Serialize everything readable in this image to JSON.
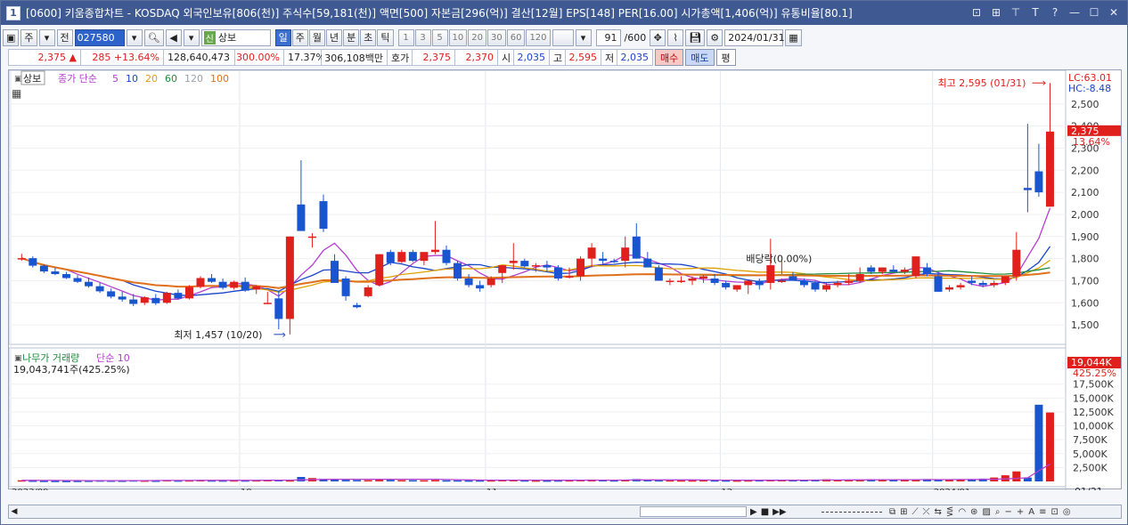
{
  "window": {
    "badge": "1",
    "title": "[0600] 키움종합차트 - KOSDAQ 외국인보유[806(천)] 주식수[59,181(천)] 액면[500] 자본금[296(억)] 결산[12월] EPS[148] PER[16.00] 시가총액[1,406(억)] 유통비율[80.1]",
    "title_buttons": [
      "⊡",
      "⊞",
      "⊤",
      "T",
      "?",
      "—",
      "☐",
      "✕"
    ]
  },
  "toolbar": {
    "ju": "주",
    "jeon": "전",
    "code": "027580",
    "shin": "신",
    "name": "상보",
    "periods": [
      "일",
      "주",
      "월",
      "년",
      "분",
      "초",
      "틱"
    ],
    "active_period": "일",
    "intervals": [
      "1",
      "3",
      "5",
      "10",
      "20",
      "30",
      "60",
      "120"
    ],
    "count": "91",
    "count_max": "/600",
    "date": "2024/01/31"
  },
  "quote": {
    "price": "2,375",
    "change": "285",
    "change_pct": "+13.64%",
    "volume": "128,640,473",
    "vol_pct": "300.00%",
    "turnover": "17.37%",
    "amount": "306,108백만",
    "hoga_label": "호가",
    "ask": "2,375",
    "bid": "2,370",
    "open_label": "시",
    "open": "2,035",
    "high_label": "고",
    "high": "2,595",
    "low_label": "저",
    "low": "2,035",
    "buy": "매수",
    "sell": "매도",
    "flat": "평"
  },
  "price_panel": {
    "stock_label": "상보",
    "ma_label": "종가 단순",
    "ma_periods": [
      "5",
      "10",
      "20",
      "60",
      "120",
      "100"
    ],
    "ma_colors": [
      "#b43fd0",
      "#1a45c8",
      "#e0a000",
      "#1e8c3a",
      "#9aa0b0",
      "#e0701c"
    ],
    "lc": "LC:63.01",
    "hc": "HC:-8.48",
    "max_annot": "최고 2,595 (01/31)",
    "min_annot": "최저 1,457 (10/20)",
    "dividend_annot": "배당락(0.00%)",
    "last_price_tag": "2,375",
    "last_pct_tag": "13.64%"
  },
  "volume_panel": {
    "label": "나무가 거래량",
    "ma_label": "단순 10",
    "value_line": "19,043,741주(425.25%)",
    "last_tag": "19,044K",
    "last_pct": "425.25%"
  },
  "x_axis": {
    "labels": [
      "2023/09",
      "10",
      "11",
      "12",
      "2024/01"
    ],
    "right_label": "01/31"
  },
  "chart_data": {
    "type": "candlestick",
    "price_axis": {
      "ticks": [
        1500,
        1600,
        1700,
        1800,
        1900,
        2000,
        2100,
        2200,
        2300,
        2400,
        2500
      ],
      "range": [
        1420,
        2620
      ]
    },
    "volume_axis": {
      "ticks": [
        "2,500K",
        "5,000K",
        "7,500K",
        "10,000K",
        "12,500K",
        "15,000K",
        "17,500K"
      ],
      "range_k": [
        0,
        20500
      ]
    },
    "candles": [
      [
        1800,
        1822,
        1790,
        1802
      ],
      [
        1802,
        1810,
        1760,
        1768
      ],
      [
        1768,
        1775,
        1735,
        1742
      ],
      [
        1742,
        1760,
        1725,
        1730
      ],
      [
        1730,
        1740,
        1708,
        1712
      ],
      [
        1712,
        1725,
        1690,
        1695
      ],
      [
        1695,
        1715,
        1668,
        1675
      ],
      [
        1675,
        1690,
        1645,
        1652
      ],
      [
        1652,
        1665,
        1620,
        1628
      ],
      [
        1628,
        1650,
        1605,
        1615
      ],
      [
        1615,
        1640,
        1585,
        1595
      ],
      [
        1600,
        1630,
        1590,
        1625
      ],
      [
        1622,
        1640,
        1590,
        1598
      ],
      [
        1600,
        1650,
        1595,
        1645
      ],
      [
        1645,
        1660,
        1615,
        1620
      ],
      [
        1620,
        1680,
        1615,
        1672
      ],
      [
        1672,
        1720,
        1665,
        1712
      ],
      [
        1712,
        1730,
        1690,
        1695
      ],
      [
        1695,
        1710,
        1660,
        1668
      ],
      [
        1668,
        1700,
        1660,
        1695
      ],
      [
        1695,
        1715,
        1650,
        1655
      ],
      [
        1660,
        1680,
        1640,
        1675
      ],
      [
        1598,
        1650,
        1595,
        1600
      ],
      [
        1620,
        1655,
        1480,
        1527
      ],
      [
        1527,
        1900,
        1457,
        1900
      ],
      [
        2045,
        2245,
        2035,
        1925
      ],
      [
        1900,
        1915,
        1850,
        1900
      ],
      [
        2060,
        2090,
        1920,
        1935
      ],
      [
        1790,
        1820,
        1700,
        1690
      ],
      [
        1710,
        1720,
        1610,
        1630
      ],
      [
        1590,
        1600,
        1575,
        1580
      ],
      [
        1630,
        1680,
        1625,
        1670
      ],
      [
        1680,
        1820,
        1675,
        1820
      ],
      [
        1830,
        1840,
        1770,
        1780
      ],
      [
        1785,
        1840,
        1780,
        1830
      ],
      [
        1830,
        1840,
        1785,
        1790
      ],
      [
        1790,
        1800,
        1770,
        1830
      ],
      [
        1830,
        1970,
        1820,
        1840
      ],
      [
        1840,
        1860,
        1770,
        1780
      ],
      [
        1780,
        1790,
        1700,
        1710
      ],
      [
        1710,
        1730,
        1670,
        1680
      ],
      [
        1680,
        1700,
        1650,
        1665
      ],
      [
        1680,
        1720,
        1670,
        1710
      ],
      [
        1735,
        1760,
        1690,
        1770
      ],
      [
        1780,
        1870,
        1750,
        1790
      ],
      [
        1790,
        1800,
        1760,
        1765
      ],
      [
        1765,
        1780,
        1740,
        1770
      ],
      [
        1770,
        1790,
        1740,
        1760
      ],
      [
        1760,
        1770,
        1700,
        1710
      ],
      [
        1720,
        1760,
        1710,
        1720
      ],
      [
        1720,
        1810,
        1700,
        1800
      ],
      [
        1800,
        1870,
        1760,
        1850
      ],
      [
        1800,
        1830,
        1775,
        1790
      ],
      [
        1790,
        1800,
        1780,
        1785
      ],
      [
        1790,
        1900,
        1760,
        1850
      ],
      [
        1900,
        1960,
        1800,
        1800
      ],
      [
        1800,
        1830,
        1760,
        1760
      ],
      [
        1760,
        1770,
        1700,
        1700
      ],
      [
        1700,
        1710,
        1680,
        1700
      ],
      [
        1700,
        1720,
        1690,
        1700
      ],
      [
        1700,
        1720,
        1680,
        1710
      ],
      [
        1710,
        1725,
        1690,
        1720
      ],
      [
        1710,
        1730,
        1680,
        1690
      ],
      [
        1690,
        1700,
        1660,
        1670
      ],
      [
        1660,
        1680,
        1650,
        1680
      ],
      [
        1680,
        1700,
        1640,
        1700
      ],
      [
        1700,
        1710,
        1660,
        1680
      ],
      [
        1690,
        1890,
        1660,
        1770
      ],
      [
        1700,
        1710,
        1690,
        1700
      ],
      [
        1720,
        1740,
        1700,
        1700
      ],
      [
        1700,
        1710,
        1670,
        1680
      ],
      [
        1690,
        1700,
        1650,
        1660
      ],
      [
        1660,
        1690,
        1650,
        1680
      ],
      [
        1680,
        1700,
        1670,
        1690
      ],
      [
        1690,
        1730,
        1680,
        1700
      ],
      [
        1700,
        1760,
        1690,
        1730
      ],
      [
        1760,
        1770,
        1730,
        1740
      ],
      [
        1740,
        1760,
        1730,
        1760
      ],
      [
        1750,
        1770,
        1740,
        1740
      ],
      [
        1740,
        1760,
        1730,
        1750
      ],
      [
        1720,
        1810,
        1710,
        1810
      ],
      [
        1760,
        1780,
        1720,
        1730
      ],
      [
        1720,
        1740,
        1650,
        1650
      ],
      [
        1660,
        1680,
        1650,
        1670
      ],
      [
        1670,
        1690,
        1660,
        1680
      ],
      [
        1700,
        1720,
        1680,
        1690
      ],
      [
        1690,
        1700,
        1670,
        1680
      ],
      [
        1680,
        1700,
        1670,
        1690
      ],
      [
        1690,
        1720,
        1680,
        1720
      ],
      [
        1720,
        1920,
        1700,
        1840
      ],
      [
        2120,
        2410,
        2010,
        2110
      ],
      [
        2195,
        2320,
        2080,
        2100
      ],
      [
        2035,
        2595,
        2035,
        2375
      ]
    ],
    "volumes_k": [
      200,
      150,
      120,
      110,
      100,
      120,
      140,
      180,
      160,
      150,
      200,
      170,
      150,
      230,
      180,
      200,
      230,
      190,
      180,
      200,
      190,
      210,
      240,
      280,
      200,
      800,
      600,
      450,
      330,
      280,
      240,
      230,
      300,
      280,
      230,
      220,
      210,
      250,
      200,
      200,
      180,
      190,
      200,
      240,
      260,
      200,
      180,
      170,
      190,
      210,
      300,
      340,
      230,
      200,
      250,
      420,
      250,
      220,
      210,
      200,
      200,
      220,
      200,
      190,
      180,
      200,
      220,
      240,
      260,
      220,
      300,
      340,
      380,
      300,
      320,
      340,
      260,
      300,
      280,
      260,
      290,
      420,
      400,
      350,
      360,
      420,
      500,
      700,
      1100,
      1800,
      700,
      13800,
      12400,
      5400,
      19044
    ],
    "volume_ma": [
      200,
      190,
      180,
      170,
      160,
      155,
      150,
      150,
      150,
      150,
      150,
      150,
      160,
      170,
      170,
      180,
      190,
      195,
      200,
      200,
      200,
      200,
      210,
      220,
      220,
      280,
      320,
      350,
      370,
      380,
      380,
      390,
      390,
      390,
      390,
      390,
      390,
      380,
      340,
      300,
      280,
      240,
      230,
      220,
      220,
      220,
      220,
      220,
      210,
      210,
      210,
      220,
      230,
      230,
      240,
      270,
      270,
      270,
      270,
      270,
      270,
      260,
      240,
      230,
      220,
      210,
      210,
      210,
      210,
      210,
      220,
      230,
      250,
      260,
      270,
      280,
      290,
      300,
      310,
      310,
      310,
      320,
      320,
      320,
      330,
      340,
      350,
      380,
      450,
      550,
      650,
      1900,
      3100,
      3600,
      5500
    ]
  }
}
